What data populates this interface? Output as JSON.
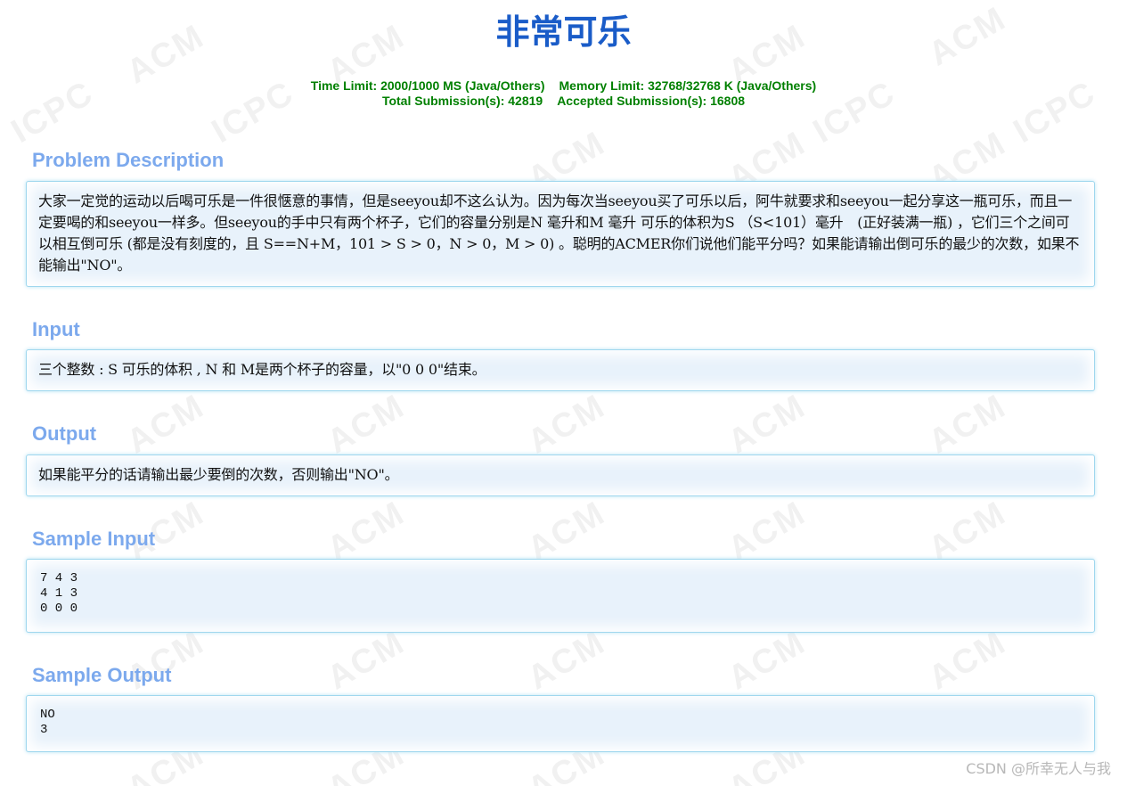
{
  "problem": {
    "title": "非常可乐",
    "time_limit": "Time Limit: 2000/1000 MS (Java/Others)",
    "memory_limit": "Memory Limit: 32768/32768 K (Java/Others)",
    "total_submissions": "Total Submission(s): 42819",
    "accepted_submissions": "Accepted Submission(s): 16808"
  },
  "sections": {
    "description": {
      "heading": "Problem Description",
      "body": "大家一定觉的运动以后喝可乐是一件很惬意的事情，但是seeyou却不这么认为。因为每次当seeyou买了可乐以后，阿牛就要求和seeyou一起分享这一瓶可乐，而且一定要喝的和seeyou一样多。但seeyou的手中只有两个杯子，它们的容量分别是N 毫升和M 毫升 可乐的体积为S （S<101）毫升　(正好装满一瓶) ，它们三个之间可以相互倒可乐 (都是没有刻度的，且 S==N+M，101 > S > 0，N > 0，M > 0) 。聪明的ACMER你们说他们能平分吗？如果能请输出倒可乐的最少的次数，如果不能输出\"NO\"。"
    },
    "input": {
      "heading": "Input",
      "body": "三个整数 : S 可乐的体积 , N 和 M是两个杯子的容量，以\"0 0 0\"结束。"
    },
    "output": {
      "heading": "Output",
      "body": "如果能平分的话请输出最少要倒的次数，否则输出\"NO\"。"
    },
    "sample_input": {
      "heading": "Sample Input",
      "body": "7 4 3\n4 1 3\n0 0 0"
    },
    "sample_output": {
      "heading": "Sample Output",
      "body": "NO\n3"
    }
  },
  "watermark": {
    "text_acm": "ACM",
    "text_icpc": "ICPC",
    "footer": "CSDN @所幸无人与我"
  },
  "colors": {
    "title": "#1a5cc8",
    "limits": "#008000",
    "section_heading": "#7ca9ed",
    "panel_border": "#9fd7ee",
    "panel_background": "#e8f2fb"
  }
}
